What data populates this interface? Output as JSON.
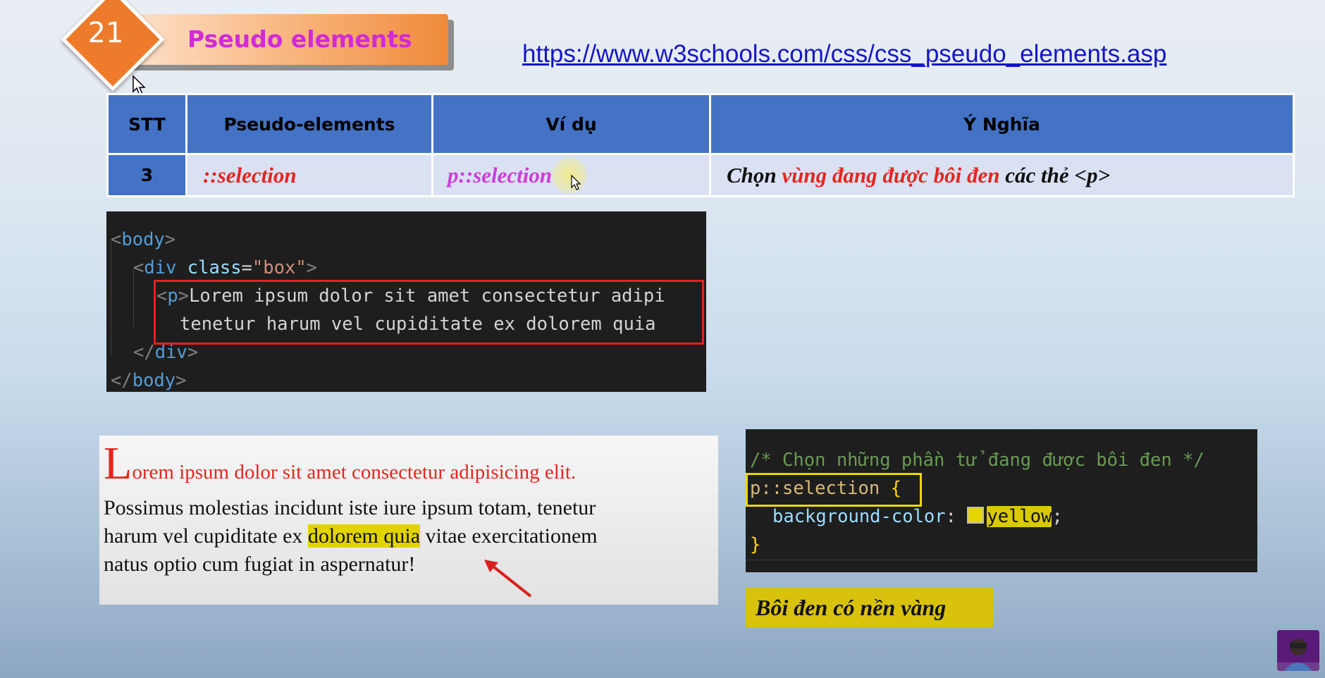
{
  "header": {
    "number": "21",
    "title": "Pseudo elements",
    "url": "https://www.w3schools.com/css/css_pseudo_elements.asp"
  },
  "table": {
    "headers": [
      "STT",
      "Pseudo-elements",
      "Ví dụ",
      "Ý Nghĩa"
    ],
    "row": {
      "stt": "3",
      "pseudo": "::selection",
      "example": "p::selection",
      "meaning_a": "Chọn ",
      "meaning_red": "vùng đang được bôi đen",
      "meaning_b": " các thẻ <p>"
    }
  },
  "code_html": {
    "body_open": "body",
    "div_tag": "div",
    "attr": "class",
    "attr_val": "\"box\"",
    "p_tag": "p",
    "line3_text": "Lorem ipsum dolor sit amet consectetur adipi",
    "line4_text": "tenetur harum vel cupiditate ex dolorem quia",
    "div_close": "div",
    "body_close": "body"
  },
  "demo": {
    "dropcap": "L",
    "line1_rest": "orem ipsum dolor sit amet consectetur adipisicing elit.",
    "line2": "Possimus molestias incidunt iste iure ipsum totam, tenetur",
    "line3_before": "harum vel cupiditate ex ",
    "line3_selected": "dolorem quia",
    "line3_after": " vitae exercitationem",
    "line4": "natus optio cum fugiat in aspernatur!",
    "selection_color": "#e1d300"
  },
  "code_css": {
    "comment": "/* Chọn những phần tử đang được bôi đen */",
    "selector": "p::selection",
    "brace_open": "{",
    "property": "background-color",
    "colon": ":",
    "value": "yellow",
    "semicolon": ";",
    "brace_close": "}"
  },
  "caption": "Bôi đen có nền vàng",
  "colors": {
    "header_blue": "#4472c4",
    "row_bg": "#d9e1f2",
    "accent_red": "#e5261f",
    "accent_magenta": "#cc3dd8",
    "highlight_yellow": "#d8c20c",
    "badge_orange": "#ee7a2c"
  },
  "icons": [
    "mouse-cursor-icon",
    "arrow-annotation-icon",
    "channel-avatar-icon"
  ]
}
